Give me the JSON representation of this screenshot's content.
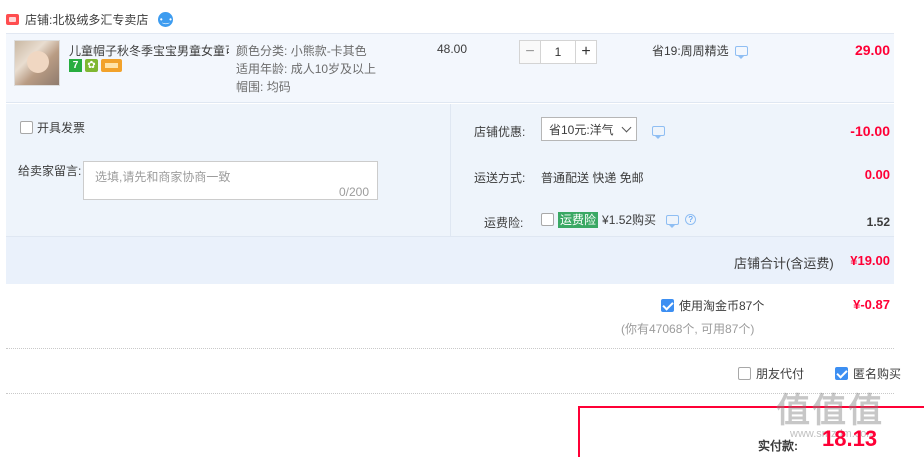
{
  "shop": {
    "label": "店铺:",
    "name": "北极绒多汇专卖店"
  },
  "item": {
    "title": "儿童帽子秋冬季宝宝男童女童可...",
    "badge_7": "7",
    "attrs": [
      {
        "key": "颜色分类:",
        "value": "小熊款-卡其色"
      },
      {
        "key": "适用年龄:",
        "value": "成人10岁及以上"
      },
      {
        "key": "帽围:",
        "value": "均码"
      }
    ],
    "unit_price": "48.00",
    "quantity": "1",
    "minus": "−",
    "plus": "+",
    "promo": "省19:周周精选",
    "total": "29.00"
  },
  "invoice": {
    "label": "开具发票"
  },
  "message": {
    "label": "给卖家留言:",
    "placeholder": "选填,请先和商家协商一致",
    "counter": "0/200"
  },
  "coupon": {
    "label": "店铺优惠:",
    "selected": "省10元:洋气",
    "value": "-10.00"
  },
  "shipping": {
    "label": "运送方式:",
    "method": "普通配送 快递 免邮",
    "fee": "0.00"
  },
  "insurance": {
    "label": "运费险:",
    "tag": "运费险",
    "price_text": "¥1.52购买",
    "value": "1.52"
  },
  "subtotal": {
    "label": "店铺合计(含运费)",
    "value": "¥19.00"
  },
  "coins": {
    "label": "使用淘金币87个",
    "value": "¥-0.87",
    "note": "(你有47068个, 可用87个)"
  },
  "options": {
    "friend_pay": "朋友代付",
    "anonymous": "匿名购买"
  },
  "payment": {
    "label": "实付款:",
    "value": "18.13"
  },
  "watermark": {
    "text": "值值值",
    "sub": "www.smzdm.com"
  }
}
